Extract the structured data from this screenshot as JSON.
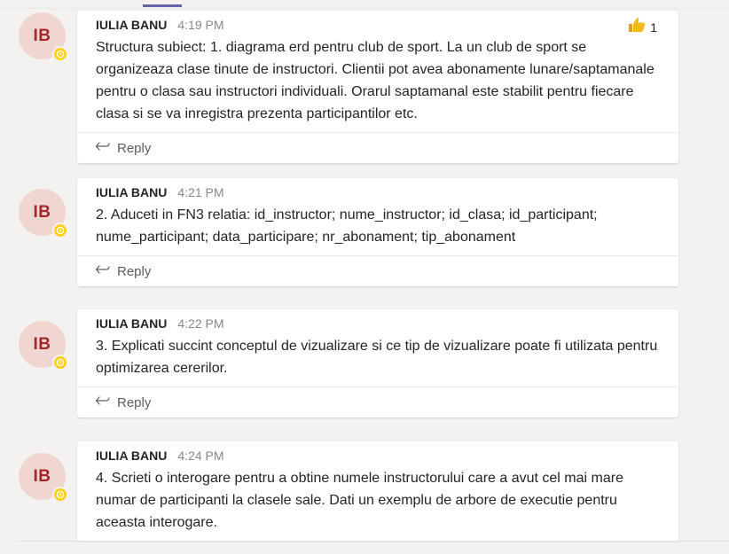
{
  "threads": [
    {
      "avatar_initials": "IB",
      "author": "IULIA BANU",
      "time": "4:19 PM",
      "text": "Structura subiect: 1. diagrama erd pentru club de sport. La un club de sport se organizeaza clase tinute de instructori. Clientii pot avea abonamente lunare/saptamanale pentru o clasa sau instructori individuali.  Orarul saptamanal este stabilit pentru fiecare clasa si se va inregistra prezenta participantilor etc.",
      "reaction": {
        "icon": "thumbs-up-icon",
        "count": "1"
      },
      "reply_label": "Reply"
    },
    {
      "avatar_initials": "IB",
      "author": "IULIA BANU",
      "time": "4:21 PM",
      "text": "2. Aduceti in FN3 relatia: id_instructor; nume_instructor; id_clasa; id_participant; nume_participant; data_participare; nr_abonament; tip_abonament",
      "reply_label": "Reply"
    },
    {
      "avatar_initials": "IB",
      "author": "IULIA BANU",
      "time": "4:22 PM",
      "text": "3. Explicati succint conceptul de vizualizare si ce tip de vizualizare poate fi utilizata pentru optimizarea cererilor.",
      "reply_label": "Reply"
    },
    {
      "avatar_initials": "IB",
      "author": "IULIA BANU",
      "time": "4:24 PM",
      "text": "4. Scrieti o interogare pentru a obtine numele instructorului care a avut cel mai mare numar de participanti la clasele sale. Dati un exemplu de arbore de executie pentru aceasta interogare."
    }
  ],
  "colors": {
    "accent": "#6264a7",
    "avatar_bg": "#f0d6d0",
    "avatar_text": "#a4262c",
    "presence_away": "#fcd116",
    "reaction_thumb": "#f2b91b"
  }
}
